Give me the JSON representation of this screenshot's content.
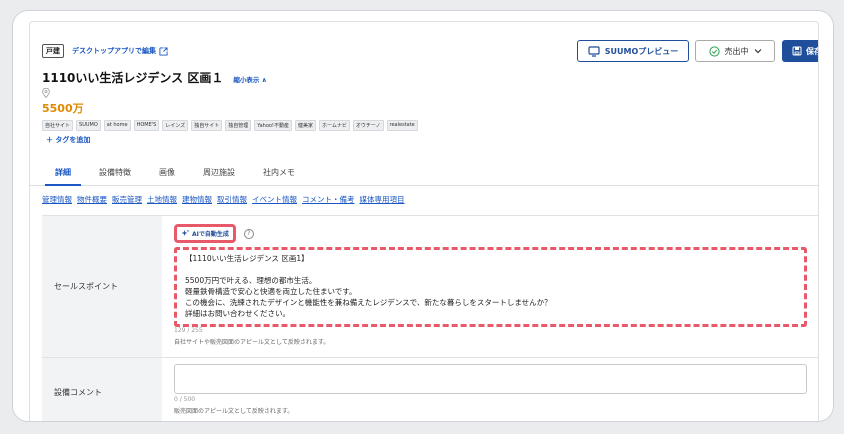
{
  "header": {
    "type_badge": "戸建",
    "desktop_link": "デスクトップアプリで編集",
    "preview_button": "SUUMOプレビュー",
    "status_select": "売出中",
    "save_button": "保存"
  },
  "property": {
    "title": "1110いい生活レジデンス 区画１",
    "collapse_link": "縮小表示 ∧",
    "price": "5500万"
  },
  "tags": [
    "自社サイト",
    "SUUMO",
    "at home",
    "HOME'S",
    "レインズ",
    "独自サイト",
    "独自管理",
    "Yahoo!不動産",
    "健美家",
    "ホームナビ",
    "オウチーノ",
    "realestate"
  ],
  "add_tag": "＋ タグを追加",
  "tabs": [
    "詳細",
    "設備特徴",
    "画像",
    "周辺施設",
    "社内メモ"
  ],
  "sublinks": [
    "管理情報",
    "物件概要",
    "販売管理",
    "土地情報",
    "建物情報",
    "取引情報",
    "イベント情報",
    "コメント・備考",
    "媒体専用項目"
  ],
  "form": {
    "sales_point": {
      "label": "セールスポイント",
      "ai_button": "AIで自動生成",
      "lines": [
        "【1110いい生活レジデンス 区画1】",
        "",
        "5500万円で叶える、理想の都市生活。",
        "軽量鉄骨構造で安心と快適を両立した住まいです。",
        "この機会に、洗練されたデザインと機能性を兼ね備えたレジデンスで、新たな暮らしをスタートしませんか？",
        "詳細はお問い合わせください。"
      ],
      "counter": "129 / 255",
      "hint": "自社サイトや販売図面のアピール文として反映されます。"
    },
    "equipment_comment": {
      "label": "設備コメント",
      "counter": "0 / 500",
      "hint": "販売図面のアピール文として反映されます。"
    }
  },
  "colors": {
    "primary": "#1f4e9a",
    "link": "#1a56c4",
    "price": "#e08a00",
    "highlight": "#e85a6a",
    "status_ok": "#2e9e4f"
  }
}
